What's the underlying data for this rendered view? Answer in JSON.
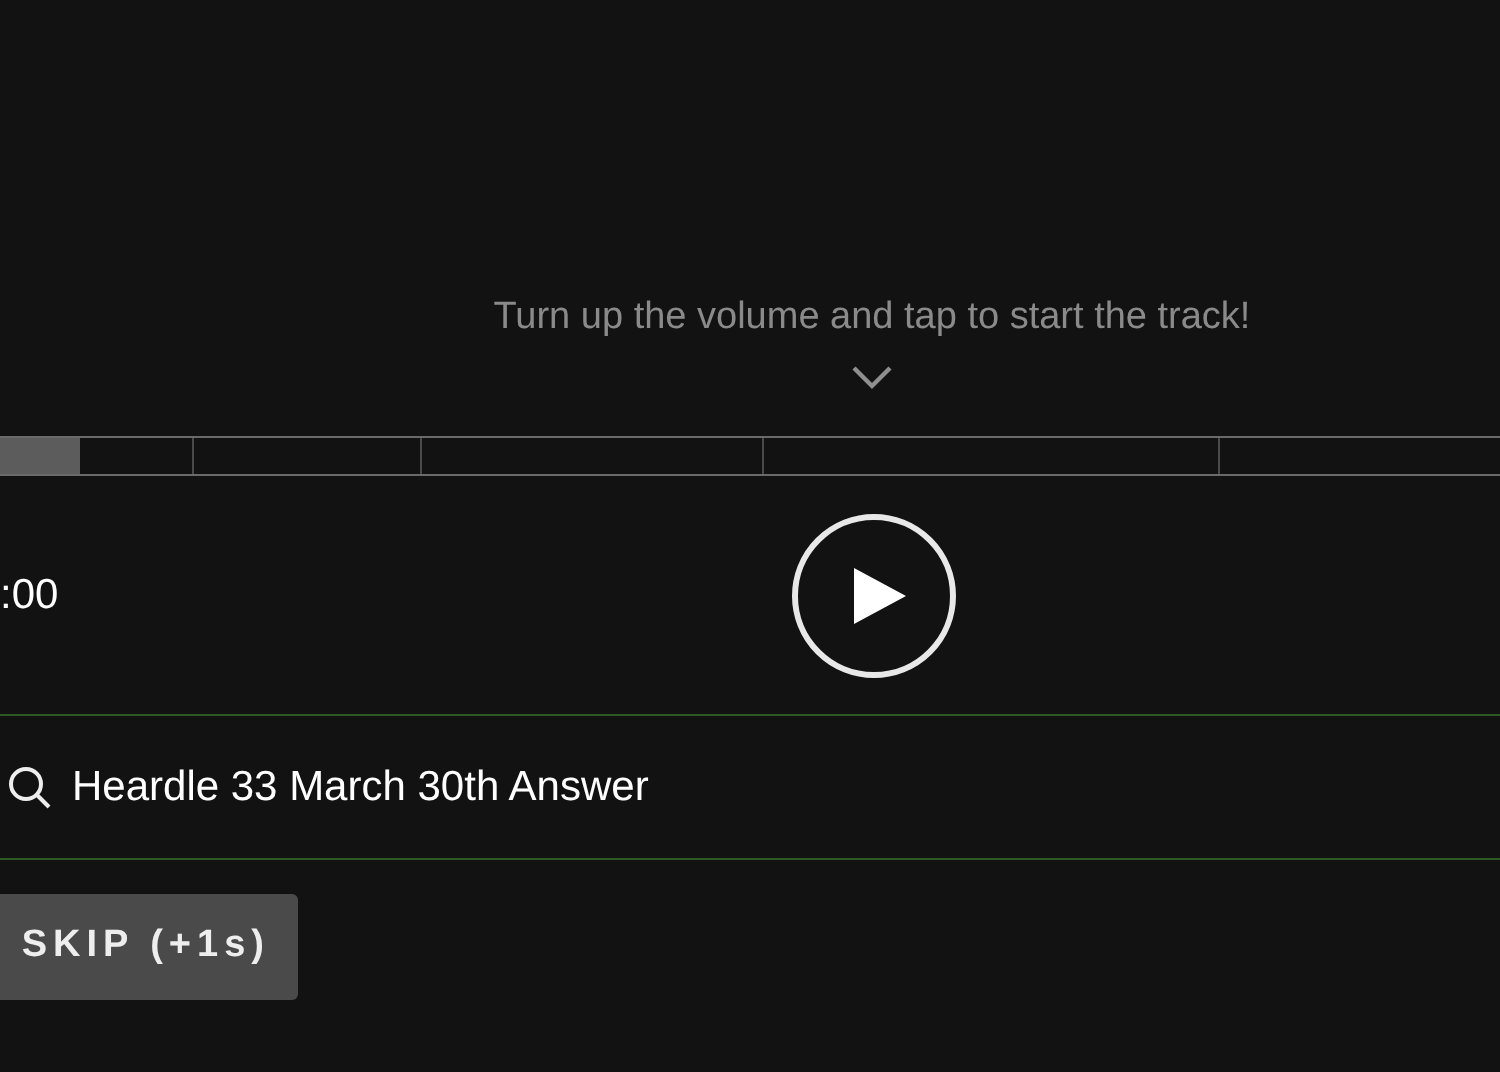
{
  "hint": "Turn up the volume and tap to start the track!",
  "progress": {
    "level": 0.0625
  },
  "time": ":00",
  "search": {
    "value": "Heardle 33 March 30th Answer"
  },
  "skip_button": "SKIP (+1s)"
}
